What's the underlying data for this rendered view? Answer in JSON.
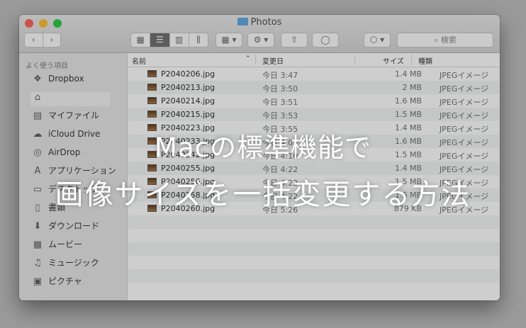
{
  "window": {
    "title": "Photos",
    "search_placeholder": "検索"
  },
  "toolbar": {
    "back": "‹",
    "forward": "›",
    "view_icons": "▦",
    "view_list": "☰",
    "view_columns": "▥",
    "view_coverflow": "⫼",
    "arrange": "▦ ▾",
    "action": "⚙ ▾",
    "share": "⇧",
    "tag": "◯",
    "dropbox": "⬡ ▾",
    "search_icon": "⌕"
  },
  "sidebar": {
    "heading": "よく使う項目",
    "items": [
      {
        "label": "Dropbox",
        "icon": "dropbox-icon",
        "glyph": "❖"
      },
      {
        "label": "",
        "icon": "home-icon",
        "glyph": "⌂"
      },
      {
        "label": "マイファイル",
        "icon": "all-my-files-icon",
        "glyph": "▤"
      },
      {
        "label": "iCloud Drive",
        "icon": "cloud-icon",
        "glyph": "☁"
      },
      {
        "label": "AirDrop",
        "icon": "airdrop-icon",
        "glyph": "◎"
      },
      {
        "label": "アプリケーション",
        "icon": "applications-icon",
        "glyph": "A"
      },
      {
        "label": "デスクトップ",
        "icon": "desktop-icon",
        "glyph": "▭"
      },
      {
        "label": "書類",
        "icon": "documents-icon",
        "glyph": "▯"
      },
      {
        "label": "ダウンロード",
        "icon": "downloads-icon",
        "glyph": "⬇"
      },
      {
        "label": "ムービー",
        "icon": "movies-icon",
        "glyph": "▦"
      },
      {
        "label": "ミュージック",
        "icon": "music-icon",
        "glyph": "♫"
      },
      {
        "label": "ピクチャ",
        "icon": "pictures-icon",
        "glyph": "▣"
      }
    ]
  },
  "columns": {
    "name": "名前",
    "date": "変更日",
    "size": "サイズ",
    "kind": "種類"
  },
  "files": [
    {
      "name": "P2040206.jpg",
      "date": "今日 3:47",
      "size": "1.4 MB",
      "kind": "JPEGイメージ"
    },
    {
      "name": "P2040213.jpg",
      "date": "今日 3:50",
      "size": "2 MB",
      "kind": "JPEGイメージ"
    },
    {
      "name": "P2040214.jpg",
      "date": "今日 3:51",
      "size": "1.6 MB",
      "kind": "JPEGイメージ"
    },
    {
      "name": "P2040215.jpg",
      "date": "今日 3:53",
      "size": "1.5 MB",
      "kind": "JPEGイメージ"
    },
    {
      "name": "P2040223.jpg",
      "date": "今日 3:55",
      "size": "1.4 MB",
      "kind": "JPEGイメージ"
    },
    {
      "name": "P2040233.jpg",
      "date": "今日 4:03",
      "size": "1.6 MB",
      "kind": "JPEGイメージ"
    },
    {
      "name": "P2040242.jpg",
      "date": "今日 4:10",
      "size": "1.5 MB",
      "kind": "JPEGイメージ"
    },
    {
      "name": "P2040255.jpg",
      "date": "今日 4:22",
      "size": "1.4 MB",
      "kind": "JPEGイメージ"
    },
    {
      "name": "P2040256.jpg",
      "date": "今日 4:22",
      "size": "1.5 MB",
      "kind": "JPEGイメージ"
    },
    {
      "name": "P2040258.jpg",
      "date": "今日 4:22",
      "size": "1.6 MB",
      "kind": "JPEGイメージ"
    },
    {
      "name": "P2040260.jpg",
      "date": "今日 5:26",
      "size": "879 KB",
      "kind": "JPEGイメージ"
    }
  ],
  "headline": {
    "line1": "Macの標準機能で",
    "line2": "画像サイズを一括変更する方法"
  }
}
